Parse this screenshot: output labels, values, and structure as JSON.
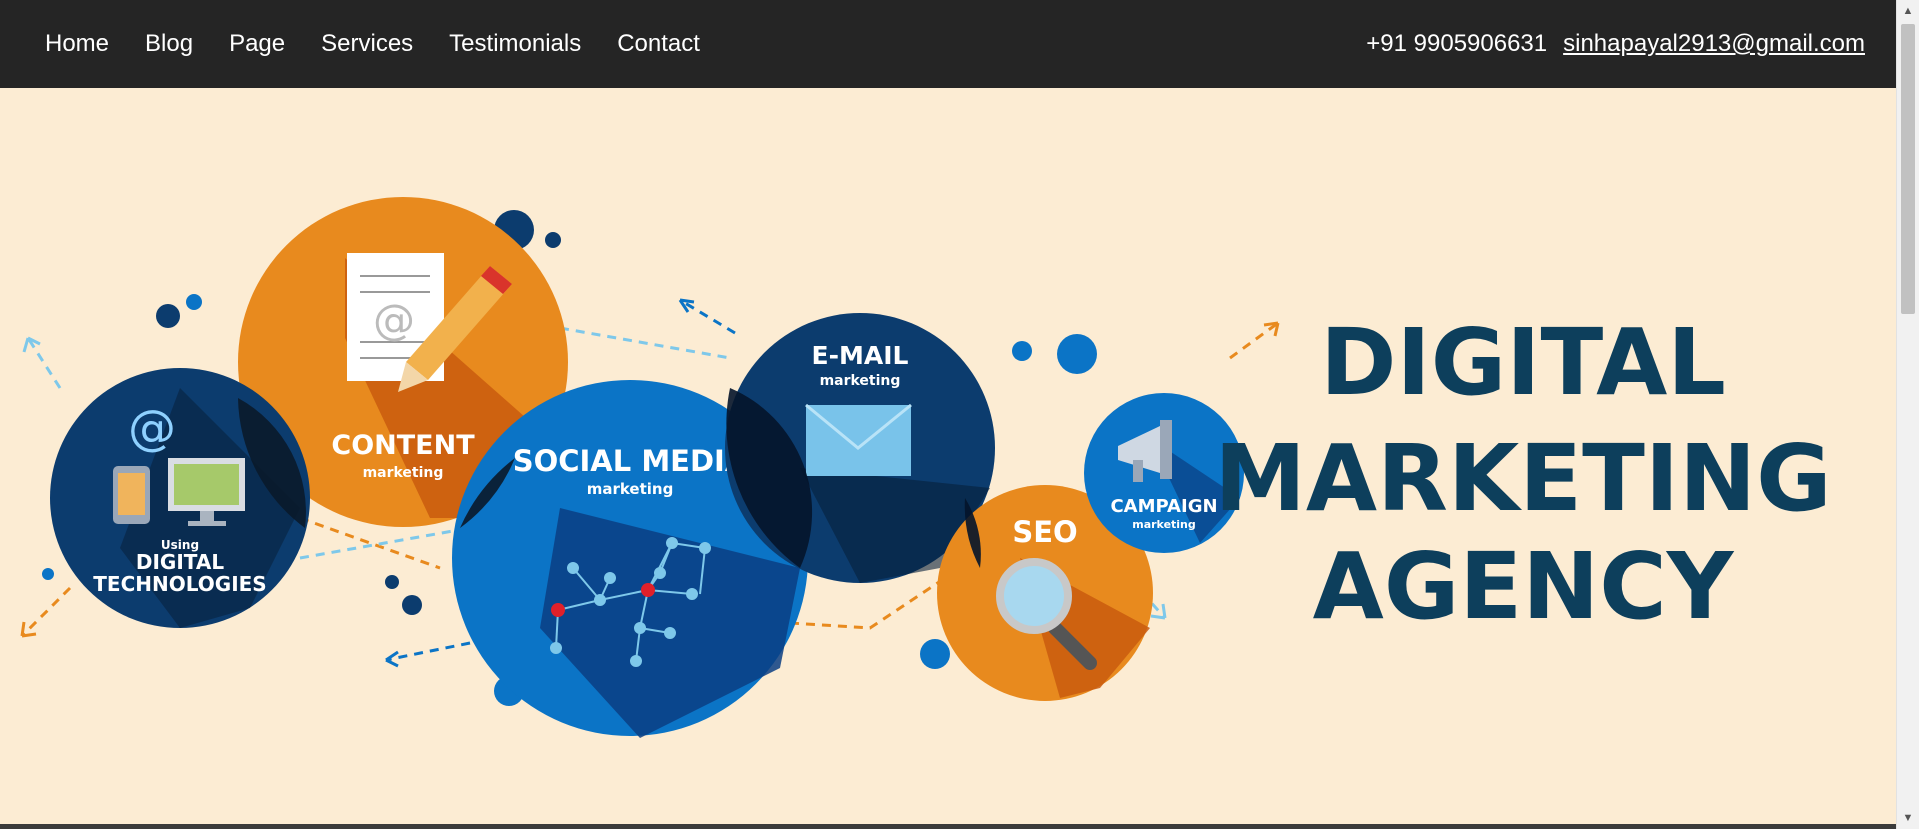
{
  "nav": {
    "links": [
      "Home",
      "Blog",
      "Page",
      "Services",
      "Testimonials",
      "Contact"
    ],
    "phone": "+91 9905906631",
    "email": "sinhapayal2913@gmail.com"
  },
  "hero": {
    "headline": [
      "DIGITAL",
      "MARKETING",
      "AGENCY"
    ],
    "circles": {
      "digital_tech": {
        "small": "Using",
        "line1": "DIGITAL",
        "line2": "TECHNOLOGIES"
      },
      "content": {
        "title": "CONTENT",
        "sub": "marketing"
      },
      "social": {
        "title": "SOCIAL MEDIA",
        "sub": "marketing"
      },
      "email": {
        "title": "E-MAIL",
        "sub": "marketing"
      },
      "seo": {
        "title": "SEO"
      },
      "campaign": {
        "title": "CAMPAIGN",
        "sub": "marketing"
      }
    }
  },
  "colors": {
    "navbar_bg": "#252525",
    "hero_bg": "#fcecd3",
    "navy": "#0c3c6e",
    "orange": "#e88a1e",
    "blue": "#0b74c6",
    "headline": "#0d3f5c"
  },
  "icons": [
    "at-sign-icon",
    "phone-icon",
    "monitor-icon",
    "document-icon",
    "pencil-icon",
    "envelope-icon",
    "magnifier-icon",
    "megaphone-icon",
    "network-icon"
  ],
  "scrollbar": {
    "up_glyph": "▲",
    "down_glyph": "▼"
  }
}
